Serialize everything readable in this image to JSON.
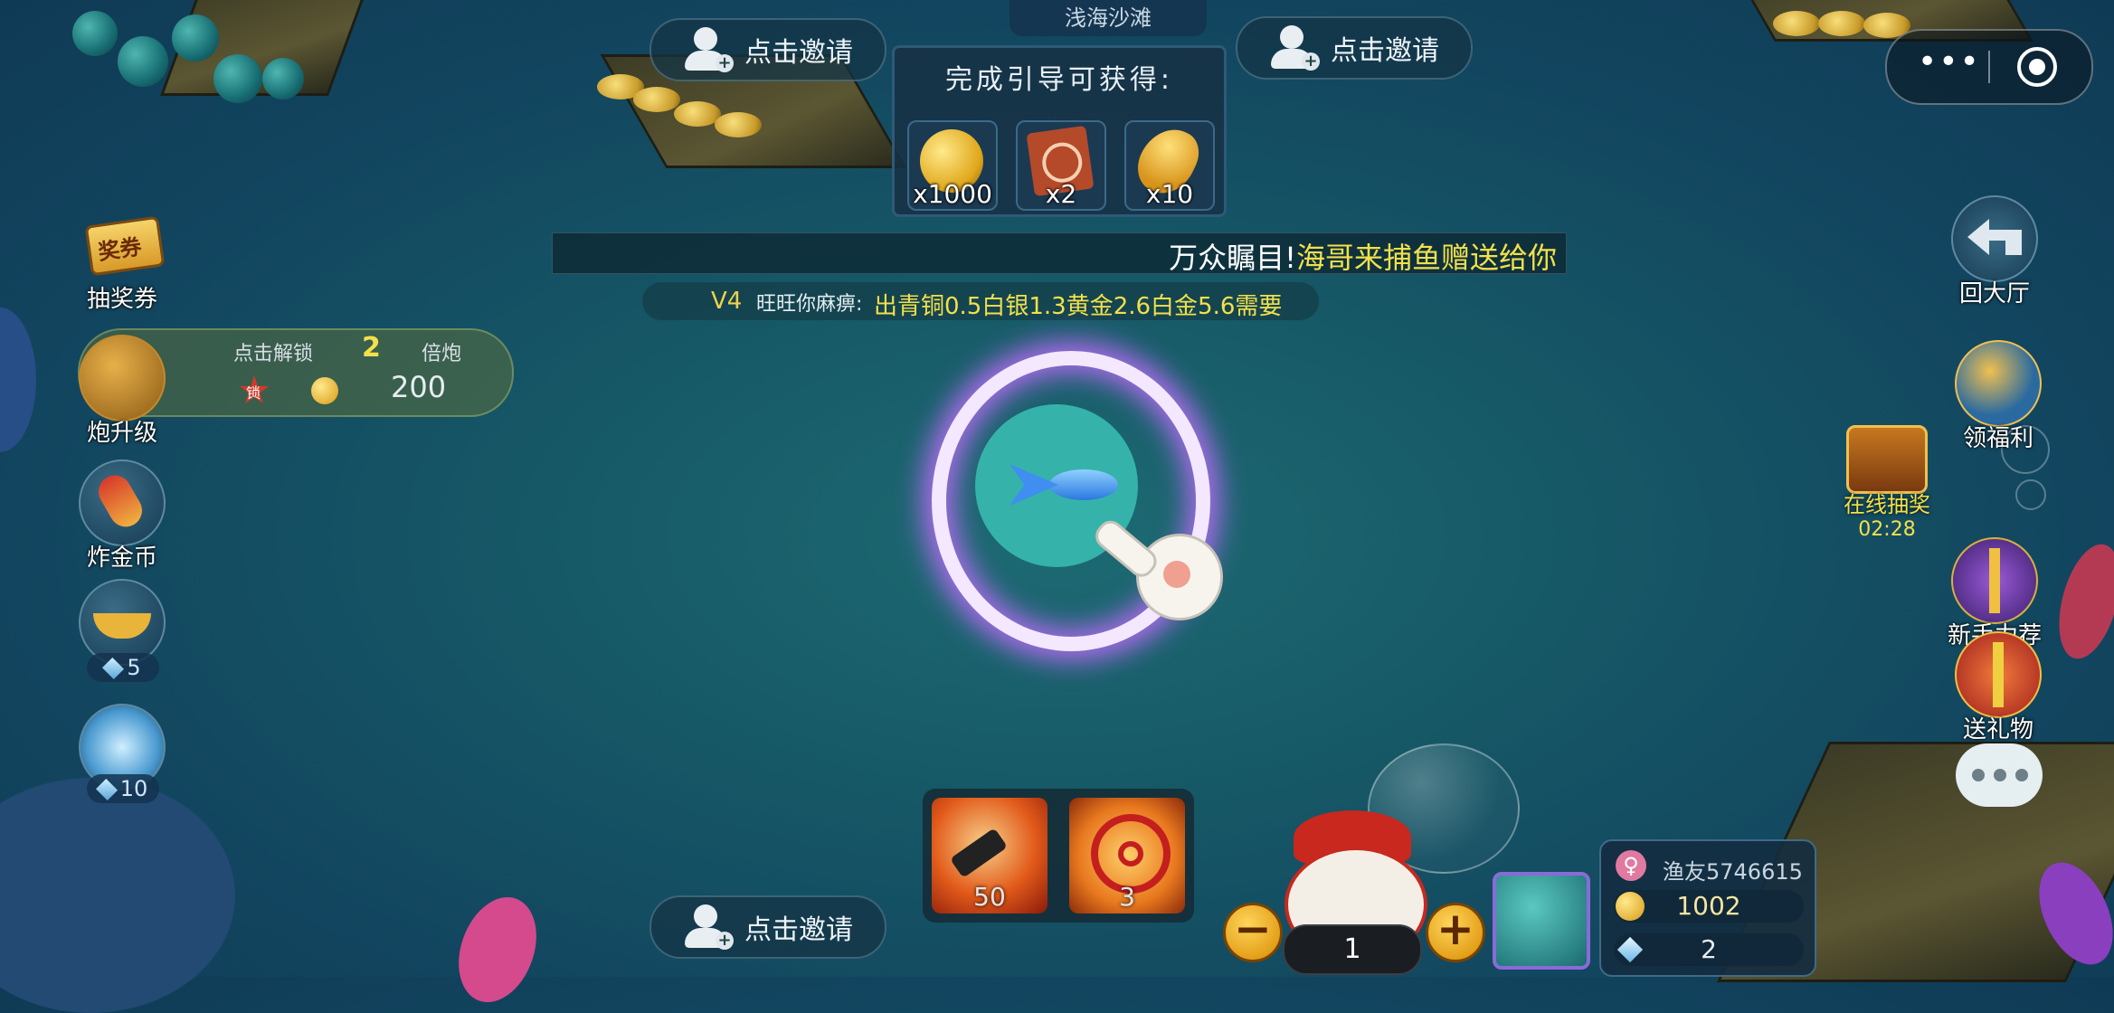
{
  "area_name": "浅海沙滩",
  "invites": {
    "top_left": "点击邀请",
    "top_right": "点击邀请",
    "bottom": "点击邀请"
  },
  "reward_panel": {
    "title": "完成引导可获得:",
    "items": [
      {
        "icon": "gold-coin-icon",
        "qty": "x1000"
      },
      {
        "icon": "target-card-icon",
        "qty": "x2"
      },
      {
        "icon": "gold-leaf-icon",
        "qty": "x10"
      }
    ]
  },
  "marquee": {
    "prefix": "万众瞩目!",
    "name": "海哥来捕鱼",
    "suffix": "赠送给你",
    "colors": {
      "white": "#ffffff",
      "yellow": "#f3e04a"
    }
  },
  "sub_marquee": {
    "vip": "V4",
    "player": "旺旺你麻痹:",
    "detail": "出青铜0.5白银1.3黄金2.6白金5.6需要"
  },
  "left_sidebar": {
    "lottery_ticket": {
      "badge": "奖券",
      "label": "抽奖券"
    },
    "cannon_upgrade": {
      "label": "炮升级"
    },
    "upgrade_panel": {
      "unlock": "点击解锁",
      "multiplier": "2",
      "multiplier_unit": "倍炮",
      "cost": "200",
      "lock_badge": "锁"
    },
    "gold_bomb": {
      "label": "炸金币"
    },
    "lamp": {
      "count": "5"
    },
    "vortex": {
      "count": "10"
    }
  },
  "skills": [
    {
      "name": "fire-cannon",
      "count": "50"
    },
    {
      "name": "lock-target",
      "count": "3"
    }
  ],
  "bet": {
    "minus": "−",
    "plus": "+",
    "value": "1"
  },
  "player": {
    "name": "渔友5746615",
    "coins": "1002",
    "gems": "2"
  },
  "right_sidebar": {
    "back": "回大厅",
    "welfare": "领福利",
    "online_lottery": "在线抽奖",
    "online_timer": "02:28",
    "newbie": "新手力荐",
    "gift": "送礼物"
  },
  "menu": {
    "more": "•••"
  }
}
